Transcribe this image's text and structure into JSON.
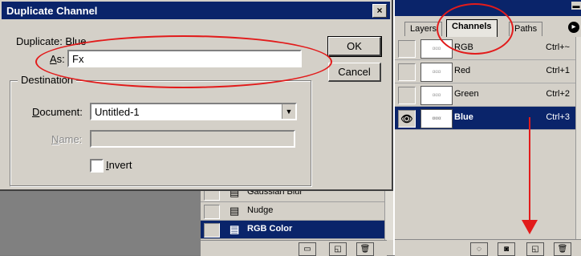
{
  "dialog": {
    "title": "Duplicate Channel",
    "close_label": "×",
    "duplicate_label": "Duplicate: Blue",
    "as_label_accesskey": "A",
    "as_label_rest": "s:",
    "as_value": "Fx",
    "ok_label": "OK",
    "cancel_label": "Cancel",
    "destination_label": "Destination",
    "document_accesskey": "D",
    "document_label_rest": "ocument:",
    "document_value": "Untitled-1",
    "name_accesskey": "N",
    "name_label_rest": "ame:",
    "name_value": "",
    "invert_accesskey": "I",
    "invert_label_rest": "nvert",
    "invert_checked": false
  },
  "channels_palette": {
    "tabs": [
      {
        "label": "Layers",
        "active": false
      },
      {
        "label": "Channels",
        "active": true
      },
      {
        "label": "Paths",
        "active": false
      }
    ],
    "channels": [
      {
        "name": "RGB",
        "shortcut": "Ctrl+~",
        "visible": false,
        "selected": false
      },
      {
        "name": "Red",
        "shortcut": "Ctrl+1",
        "visible": false,
        "selected": false
      },
      {
        "name": "Green",
        "shortcut": "Ctrl+2",
        "visible": false,
        "selected": false
      },
      {
        "name": "Blue",
        "shortcut": "Ctrl+3",
        "visible": true,
        "selected": true
      }
    ]
  },
  "actions_panel": {
    "items": [
      {
        "label": "Gaussian Blur",
        "selected": false
      },
      {
        "label": "Nudge",
        "selected": false
      },
      {
        "label": "RGB Color",
        "selected": true
      }
    ]
  },
  "annotation_color": "#e21b1b"
}
